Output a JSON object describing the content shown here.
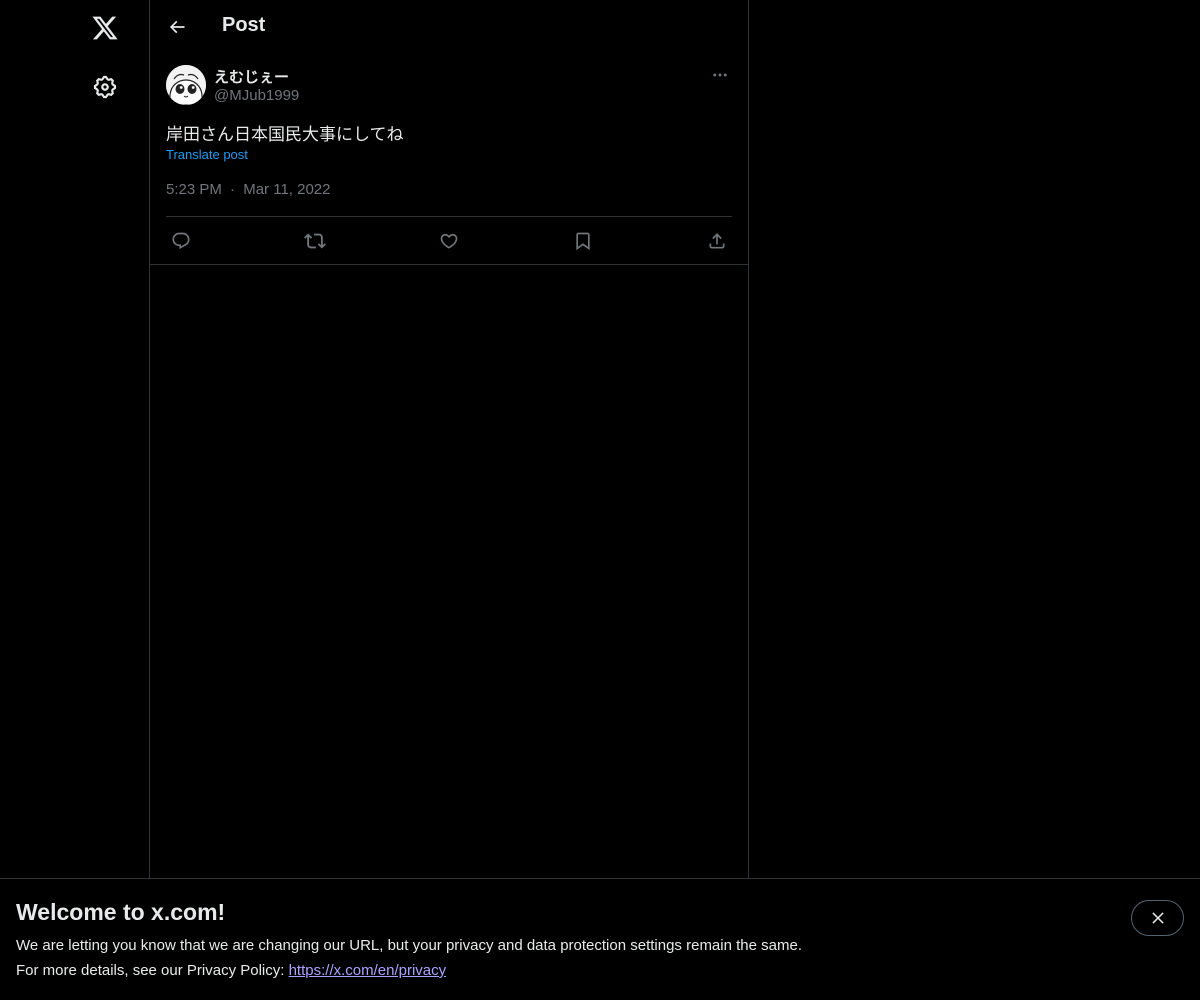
{
  "header": {
    "title": "Post",
    "back_icon": "arrow-left-icon"
  },
  "nav": {
    "logo_icon": "x-logo-icon",
    "settings_icon": "gear-icon"
  },
  "post": {
    "display_name": "えむじぇー",
    "handle": "@MJub1999",
    "text": "岸田さん日本国民大事にしてね",
    "translate_label": "Translate post",
    "time": "5:23 PM",
    "separator": "·",
    "date": "Mar 11, 2022",
    "more_icon": "more-horizontal-icon",
    "actions": [
      "reply-icon",
      "repost-icon",
      "like-icon",
      "bookmark-icon",
      "share-icon"
    ]
  },
  "banner": {
    "title": "Welcome to x.com!",
    "line1": "We are letting you know that we are changing our URL, but your privacy and data protection settings remain the same.",
    "line2_prefix": "For more details, see our Privacy Policy: ",
    "link": "https://x.com/en/privacy",
    "close_icon": "close-icon"
  },
  "colors": {
    "background": "#000000",
    "text": "#e7e9ea",
    "muted": "#71767b",
    "link_blue": "#1d9bf0",
    "border": "#2f3336",
    "banner_link": "#a9a3ff"
  }
}
